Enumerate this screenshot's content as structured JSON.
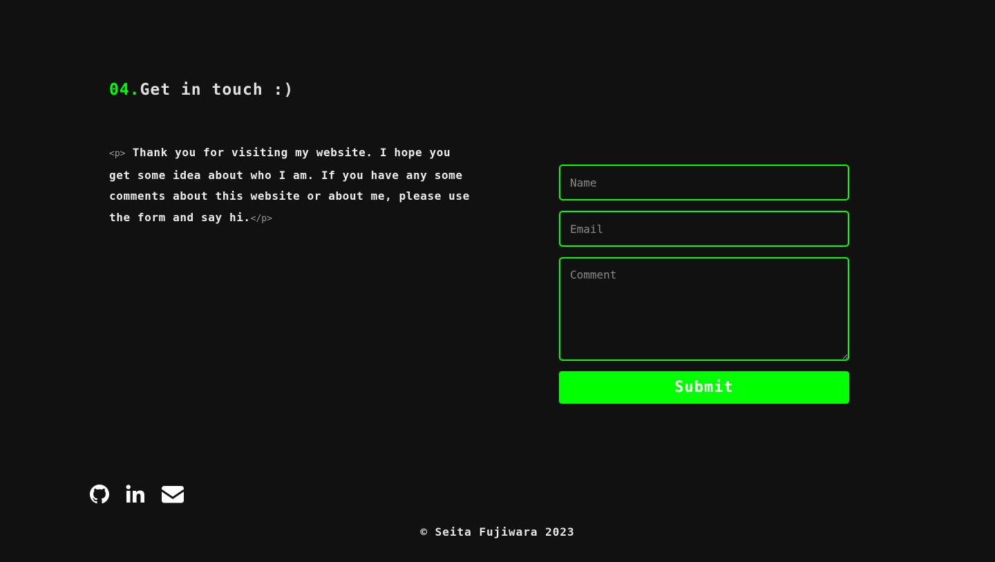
{
  "contact": {
    "number": "04.",
    "title": "Get in touch :)",
    "open_tag": "<p>",
    "message": "Thank you for visiting my website. I hope you get some idea about who I am. If you have any some comments about this website or about me, please use the form and say hi.",
    "close_tag": "</p>"
  },
  "form": {
    "name_placeholder": "Name",
    "email_placeholder": "Email",
    "comment_placeholder": "Comment",
    "submit_label": "Submit"
  },
  "socials": {
    "icons": [
      "github-icon",
      "linkedin-icon",
      "envelope-icon"
    ]
  },
  "footer": {
    "copyright": "© Seita Fujiwara 2023"
  },
  "colors": {
    "background": "#111111",
    "accent": "#00ff00",
    "text": "#e8e8e8"
  }
}
